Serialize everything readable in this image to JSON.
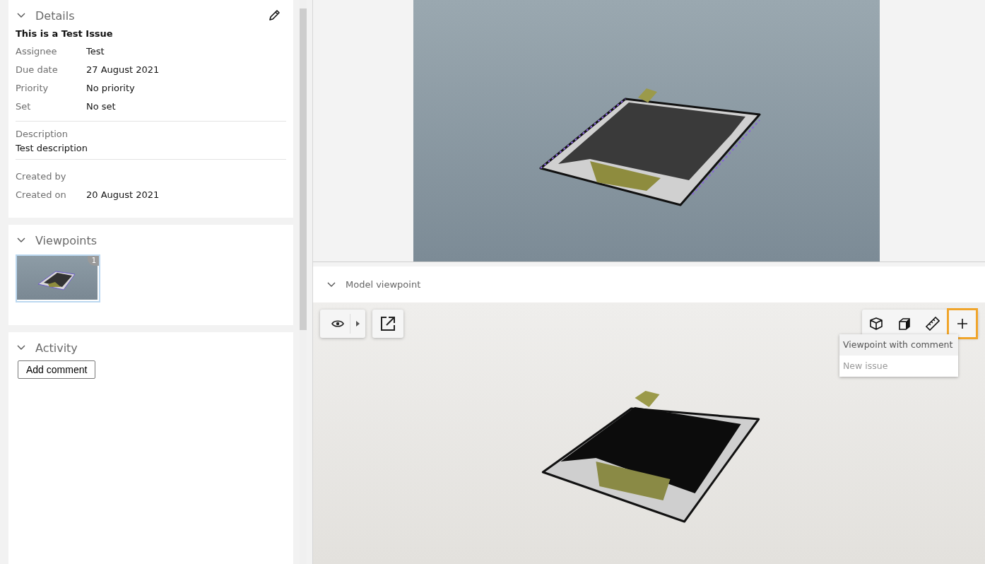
{
  "details": {
    "title": "Details",
    "expanded": true,
    "issue_title": "This is a Test Issue",
    "fields": [
      {
        "label": "Assignee",
        "value": "Test"
      },
      {
        "label": "Due date",
        "value": "27 August 2021"
      },
      {
        "label": "Priority",
        "value": "No priority"
      },
      {
        "label": "Set",
        "value": "No set"
      }
    ],
    "description_label": "Description",
    "description": "Test description",
    "meta": [
      {
        "label": "Created by"
      },
      {
        "label": "Created on",
        "value": "20 August 2021"
      }
    ]
  },
  "viewpoints": {
    "title": "Viewpoints",
    "expanded": true,
    "thumbnails": [
      {
        "badge": "1",
        "selected": true
      }
    ]
  },
  "activity": {
    "title": "Activity",
    "expanded": true,
    "button": "Add comment"
  },
  "model_viewpoint": {
    "title": "Model viewpoint",
    "expanded": true,
    "left_tools": [
      {
        "kind": "eye"
      },
      {
        "kind": "external"
      }
    ],
    "right_tools": [
      {
        "kind": "cube",
        "highlighted": false
      },
      {
        "kind": "solid-cube",
        "highlighted": false
      },
      {
        "kind": "ruler",
        "highlighted": false
      },
      {
        "kind": "plus",
        "highlighted": true
      }
    ],
    "menu": [
      {
        "label": "Viewpoint with comment",
        "selected": true,
        "disabled": false
      },
      {
        "label": "New issue",
        "selected": false,
        "disabled": true
      }
    ]
  }
}
